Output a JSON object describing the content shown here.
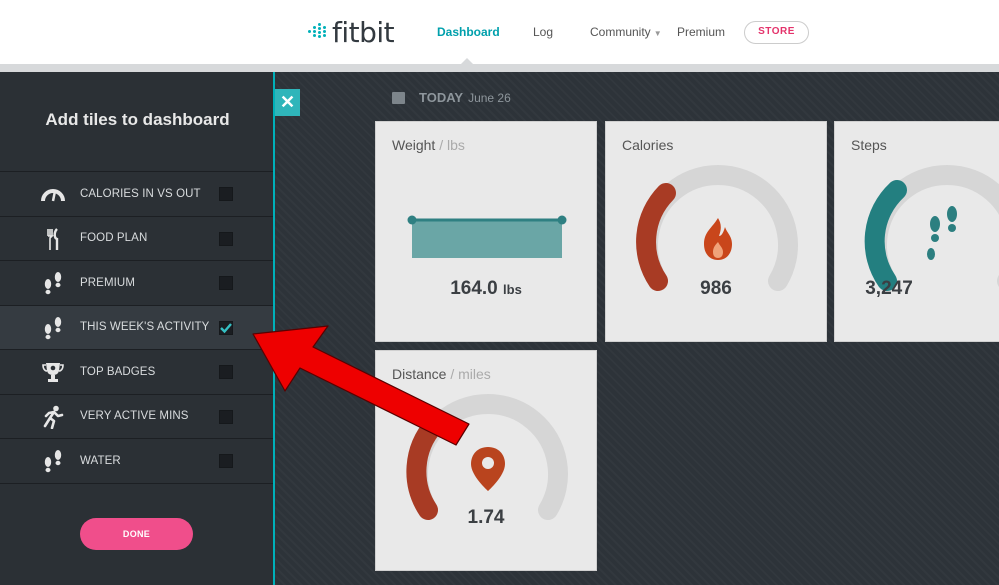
{
  "header": {
    "logo_text": "fitbit",
    "nav": {
      "dashboard": "Dashboard",
      "log": "Log",
      "community": "Community",
      "premium": "Premium",
      "store": "STORE"
    }
  },
  "panel": {
    "title": "Add tiles to dashboard",
    "items": [
      {
        "label": "CALORIES IN VS OUT",
        "icon": "gauge-icon",
        "checked": false
      },
      {
        "label": "FOOD PLAN",
        "icon": "fork-knife-icon",
        "checked": false
      },
      {
        "label": "PREMIUM",
        "icon": "footprints-icon",
        "checked": false
      },
      {
        "label": "THIS WEEK'S ACTIVITY",
        "icon": "footprints-icon",
        "checked": true
      },
      {
        "label": "TOP BADGES",
        "icon": "trophy-icon",
        "checked": false
      },
      {
        "label": "VERY ACTIVE MINS",
        "icon": "runner-icon",
        "checked": false
      },
      {
        "label": "WATER",
        "icon": "footprints-icon",
        "checked": false
      }
    ],
    "done_label": "DONE",
    "close_glyph": "✕"
  },
  "dashboard": {
    "today_label": "TODAY",
    "today_date": "June 26",
    "tiles": {
      "weight": {
        "title": "Weight",
        "unit": "/ lbs",
        "value": "164.0",
        "value_unit": "lbs"
      },
      "calories": {
        "title": "Calories",
        "value": "986",
        "progress": 0.3
      },
      "steps": {
        "title": "Steps",
        "value": "3,247",
        "progress": 0.28
      },
      "distance": {
        "title": "Distance",
        "unit": "/ miles",
        "value": "1.74",
        "progress": 0.27
      }
    }
  },
  "colors": {
    "accent": "#00b0b9",
    "calories_arc": "#a83b24",
    "steps_arc": "#237f80",
    "distance_arc": "#a83b24",
    "weight_bar": "#5fa3a3",
    "done_button": "#f04e8b",
    "arrow": "#ee0000"
  }
}
